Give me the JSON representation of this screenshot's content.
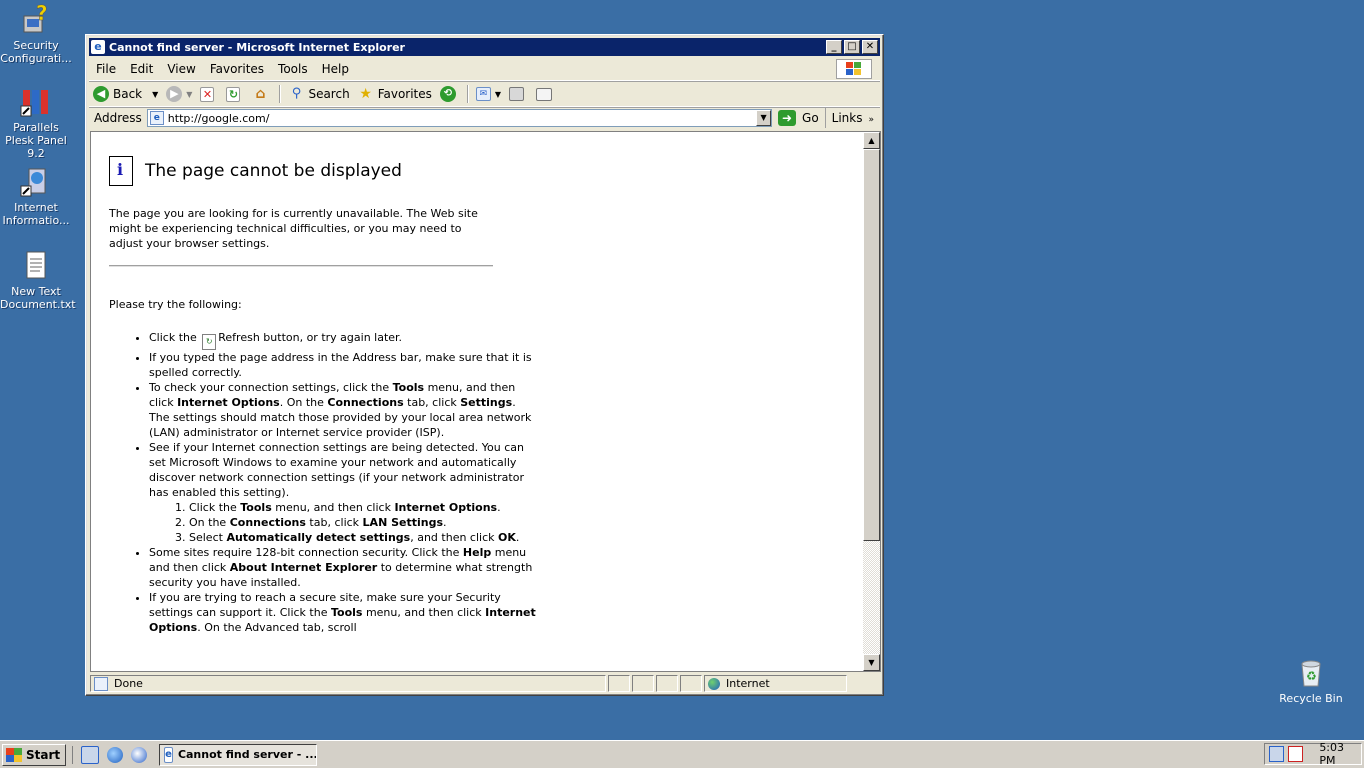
{
  "desktop": {
    "icons": [
      {
        "label": "Security Configurati..."
      },
      {
        "label": "Parallels Plesk Panel 9.2"
      },
      {
        "label": "Internet Informatio..."
      },
      {
        "label": "New Text Document.txt"
      }
    ],
    "recycle_bin": "Recycle Bin"
  },
  "window": {
    "title": "Cannot find server - Microsoft Internet Explorer",
    "menu": [
      "File",
      "Edit",
      "View",
      "Favorites",
      "Tools",
      "Help"
    ],
    "toolbar": {
      "back": "Back",
      "search": "Search",
      "favorites": "Favorites"
    },
    "address": {
      "label": "Address",
      "url": "http://google.com/",
      "go": "Go",
      "links": "Links"
    }
  },
  "page": {
    "heading": "The page cannot be displayed",
    "intro": "The page you are looking for is currently unavailable. The Web site might be experiencing technical difficulties, or you may need to adjust your browser settings.",
    "try": "Please try the following:",
    "tip1_a": "Click the",
    "tip1_b": "Refresh button, or try again later.",
    "tip2": "If you typed the page address in the Address bar, make sure that it is spelled correctly.",
    "tip3": {
      "t1": "To check your connection settings, click the ",
      "b1": "Tools",
      "t2": " menu, and then click ",
      "b2": "Internet Options",
      "t3": ". On the ",
      "b3": "Connections",
      "t4": " tab, click ",
      "b4": "Settings",
      "t5": ". The settings should match those provided by your local area network (LAN) administrator or Internet service provider (ISP)."
    },
    "tip4": "See if your Internet connection settings are being detected. You can set Microsoft Windows to examine your network and automatically discover network connection settings (if your network administrator has enabled this setting).",
    "sub1": {
      "t1": "Click the ",
      "b1": "Tools",
      "t2": " menu, and then click ",
      "b2": "Internet Options",
      "t3": "."
    },
    "sub2": {
      "t1": "On the ",
      "b1": "Connections",
      "t2": " tab, click ",
      "b2": "LAN Settings",
      "t3": "."
    },
    "sub3": {
      "t1": "Select ",
      "b1": "Automatically detect settings",
      "t2": ", and then click ",
      "b2": "OK",
      "t3": "."
    },
    "tip5": {
      "t1": "Some sites require 128-bit connection security. Click the ",
      "b1": "Help",
      "t2": " menu and then click ",
      "b2": "About Internet Explorer",
      "t3": " to determine what strength security you have installed."
    },
    "tip6": {
      "t1": "If you are trying to reach a secure site, make sure your Security settings can support it. Click the ",
      "b1": "Tools",
      "t2": " menu, and then click ",
      "b2": "Internet Options",
      "t3": ". On the Advanced tab, scroll"
    }
  },
  "status": {
    "text": "Done",
    "zone": "Internet"
  },
  "taskbar": {
    "start": "Start",
    "task": "Cannot find server - ...",
    "clock": "5:03 PM"
  }
}
